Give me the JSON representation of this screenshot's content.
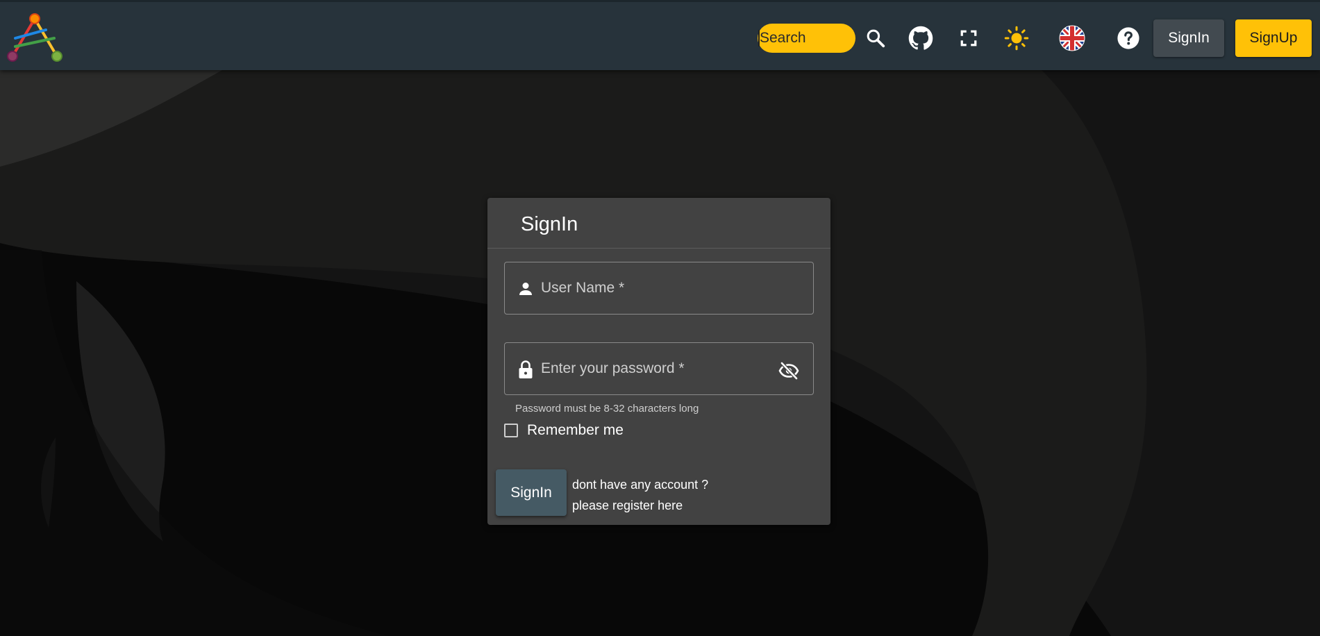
{
  "header": {
    "logo_icon": "app-logo-icon",
    "search": {
      "placeholder": "Search",
      "value": ""
    },
    "icons": [
      "search-icon",
      "github-icon",
      "fullscreen-icon",
      "sun-icon",
      "uk-flag-icon",
      "help-icon"
    ],
    "signin_label": "SignIn",
    "signup_label": "SignUp"
  },
  "signin_card": {
    "title": "SignIn",
    "username_label": "User Name *",
    "password_label": "Enter your password *",
    "password_helper": "Password must be 8-32 characters long",
    "remember_label": "Remember me",
    "remember_checked": false,
    "submit_label": "SignIn",
    "register_question": "dont have any account ?",
    "register_link": "please register here"
  },
  "colors": {
    "header_bg": "#27333b",
    "accent": "#ffc107",
    "card_bg": "#424242",
    "submit_bg": "#455a64",
    "page_bg": "#0a0a0a"
  }
}
